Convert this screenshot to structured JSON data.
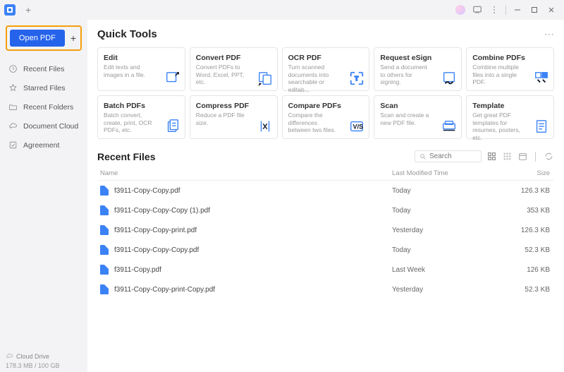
{
  "titlebar": {
    "new_tab": "+"
  },
  "sidebar": {
    "open_label": "Open PDF",
    "items": [
      {
        "label": "Recent Files",
        "icon": "clock-icon"
      },
      {
        "label": "Starred Files",
        "icon": "star-icon"
      },
      {
        "label": "Recent Folders",
        "icon": "folder-icon"
      },
      {
        "label": "Document Cloud",
        "icon": "cloud-icon"
      },
      {
        "label": "Agreement",
        "icon": "check-icon"
      }
    ],
    "cloud_drive": "Cloud Drive",
    "storage": "178.3 MB / 100 GB"
  },
  "quick_tools": {
    "title": "Quick Tools",
    "cards": [
      {
        "title": "Edit",
        "desc": "Edit texts and images in a file."
      },
      {
        "title": "Convert PDF",
        "desc": "Convert PDFs to Word, Excel, PPT, etc."
      },
      {
        "title": "OCR PDF",
        "desc": "Turn scanned documents into searchable or editab..."
      },
      {
        "title": "Request eSign",
        "desc": "Send a document to others for signing."
      },
      {
        "title": "Combine PDFs",
        "desc": "Combine multiple files into a single PDF."
      },
      {
        "title": "Batch PDFs",
        "desc": "Batch convert, create, print, OCR PDFs, etc."
      },
      {
        "title": "Compress PDF",
        "desc": "Reduce a PDF file size."
      },
      {
        "title": "Compare PDFs",
        "desc": "Compare the differences between two files."
      },
      {
        "title": "Scan",
        "desc": "Scan and create a new PDF file."
      },
      {
        "title": "Template",
        "desc": "Get great PDF templates for resumes, posters, etc."
      }
    ]
  },
  "recent": {
    "title": "Recent Files",
    "search_placeholder": "Search",
    "columns": {
      "name": "Name",
      "modified": "Last Modified Time",
      "size": "Size"
    },
    "files": [
      {
        "name": "f3911-Copy-Copy.pdf",
        "modified": "Today",
        "size": "126.3 KB"
      },
      {
        "name": "f3911-Copy-Copy-Copy (1).pdf",
        "modified": "Today",
        "size": "353 KB"
      },
      {
        "name": "f3911-Copy-Copy-print.pdf",
        "modified": "Yesterday",
        "size": "126.3 KB"
      },
      {
        "name": "f3911-Copy-Copy-Copy.pdf",
        "modified": "Today",
        "size": "52.3 KB"
      },
      {
        "name": "f3911-Copy.pdf",
        "modified": "Last Week",
        "size": "126 KB"
      },
      {
        "name": "f3911-Copy-Copy-print-Copy.pdf",
        "modified": "Yesterday",
        "size": "52.3 KB"
      }
    ]
  }
}
